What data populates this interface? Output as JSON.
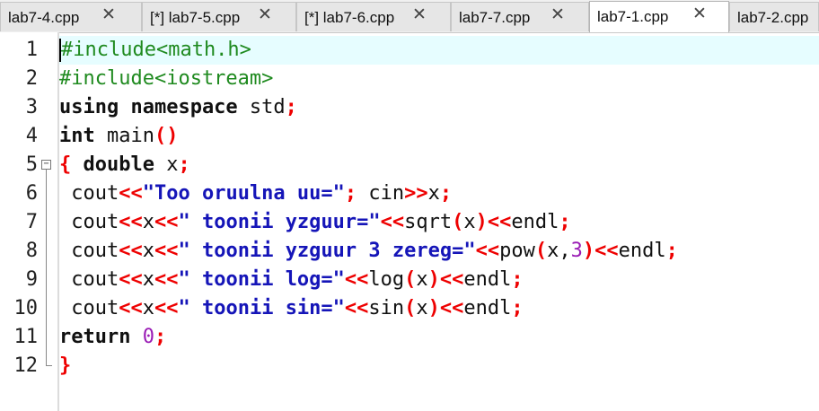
{
  "tabs": [
    {
      "label": "lab7-4.cpp",
      "close": "✕",
      "active": false
    },
    {
      "label": "[*] lab7-5.cpp",
      "close": "✕",
      "active": false
    },
    {
      "label": "[*] lab7-6.cpp",
      "close": "✕",
      "active": false
    },
    {
      "label": "lab7-7.cpp",
      "close": "✕",
      "active": false
    },
    {
      "label": "lab7-1.cpp",
      "close": "✕",
      "active": true
    },
    {
      "label": "lab7-2.cpp",
      "close": "",
      "active": false
    }
  ],
  "editor": {
    "line_numbers": [
      "1",
      "2",
      "3",
      "4",
      "5",
      "6",
      "7",
      "8",
      "9",
      "10",
      "11",
      "12"
    ],
    "fold_expand": "−",
    "lines": [
      [
        {
          "t": "#include<math.h>",
          "c": "pp"
        }
      ],
      [
        {
          "t": "#include<iostream>",
          "c": "pp"
        }
      ],
      [
        {
          "t": "using namespace",
          "c": "kw"
        },
        {
          "t": " std",
          "c": "id"
        },
        {
          "t": ";",
          "c": "op"
        }
      ],
      [
        {
          "t": "int",
          "c": "kw"
        },
        {
          "t": " main",
          "c": "id"
        },
        {
          "t": "()",
          "c": "op"
        }
      ],
      [
        {
          "t": "{",
          "c": "op"
        },
        {
          "t": " ",
          "c": "id"
        },
        {
          "t": "double",
          "c": "kw"
        },
        {
          "t": " x",
          "c": "id"
        },
        {
          "t": ";",
          "c": "op"
        }
      ],
      [
        {
          "t": " cout",
          "c": "id"
        },
        {
          "t": "<<",
          "c": "op"
        },
        {
          "t": "\"Too oruulna uu=\"",
          "c": "str"
        },
        {
          "t": ";",
          "c": "op"
        },
        {
          "t": " cin",
          "c": "id"
        },
        {
          "t": ">>",
          "c": "op"
        },
        {
          "t": "x",
          "c": "id"
        },
        {
          "t": ";",
          "c": "op"
        }
      ],
      [
        {
          "t": " cout",
          "c": "id"
        },
        {
          "t": "<<",
          "c": "op"
        },
        {
          "t": "x",
          "c": "id"
        },
        {
          "t": "<<",
          "c": "op"
        },
        {
          "t": "\" toonii yzguur=\"",
          "c": "str"
        },
        {
          "t": "<<",
          "c": "op"
        },
        {
          "t": "sqrt",
          "c": "id"
        },
        {
          "t": "(",
          "c": "op"
        },
        {
          "t": "x",
          "c": "id"
        },
        {
          "t": ")",
          "c": "op"
        },
        {
          "t": "<<",
          "c": "op"
        },
        {
          "t": "endl",
          "c": "id"
        },
        {
          "t": ";",
          "c": "op"
        }
      ],
      [
        {
          "t": " cout",
          "c": "id"
        },
        {
          "t": "<<",
          "c": "op"
        },
        {
          "t": "x",
          "c": "id"
        },
        {
          "t": "<<",
          "c": "op"
        },
        {
          "t": "\" toonii yzguur 3 zereg=\"",
          "c": "str"
        },
        {
          "t": "<<",
          "c": "op"
        },
        {
          "t": "pow",
          "c": "id"
        },
        {
          "t": "(",
          "c": "op"
        },
        {
          "t": "x,",
          "c": "id"
        },
        {
          "t": "3",
          "c": "num"
        },
        {
          "t": ")",
          "c": "op"
        },
        {
          "t": "<<",
          "c": "op"
        },
        {
          "t": "endl",
          "c": "id"
        },
        {
          "t": ";",
          "c": "op"
        }
      ],
      [
        {
          "t": " cout",
          "c": "id"
        },
        {
          "t": "<<",
          "c": "op"
        },
        {
          "t": "x",
          "c": "id"
        },
        {
          "t": "<<",
          "c": "op"
        },
        {
          "t": "\" toonii log=\"",
          "c": "str"
        },
        {
          "t": "<<",
          "c": "op"
        },
        {
          "t": "log",
          "c": "id"
        },
        {
          "t": "(",
          "c": "op"
        },
        {
          "t": "x",
          "c": "id"
        },
        {
          "t": ")",
          "c": "op"
        },
        {
          "t": "<<",
          "c": "op"
        },
        {
          "t": "endl",
          "c": "id"
        },
        {
          "t": ";",
          "c": "op"
        }
      ],
      [
        {
          "t": " cout",
          "c": "id"
        },
        {
          "t": "<<",
          "c": "op"
        },
        {
          "t": "x",
          "c": "id"
        },
        {
          "t": "<<",
          "c": "op"
        },
        {
          "t": "\" toonii sin=\"",
          "c": "str"
        },
        {
          "t": "<<",
          "c": "op"
        },
        {
          "t": "sin",
          "c": "id"
        },
        {
          "t": "(",
          "c": "op"
        },
        {
          "t": "x",
          "c": "id"
        },
        {
          "t": ")",
          "c": "op"
        },
        {
          "t": "<<",
          "c": "op"
        },
        {
          "t": "endl",
          "c": "id"
        },
        {
          "t": ";",
          "c": "op"
        }
      ],
      [
        {
          "t": "return",
          "c": "kw"
        },
        {
          "t": " ",
          "c": "id"
        },
        {
          "t": "0",
          "c": "num"
        },
        {
          "t": ";",
          "c": "op"
        }
      ],
      [
        {
          "t": "}",
          "c": "op"
        }
      ]
    ]
  },
  "colors": {
    "preprocessor": "#1f8a1f",
    "operator": "#ee0000",
    "string": "#1515b8",
    "number": "#9a1cb5",
    "current_line": "#e6fdff"
  }
}
